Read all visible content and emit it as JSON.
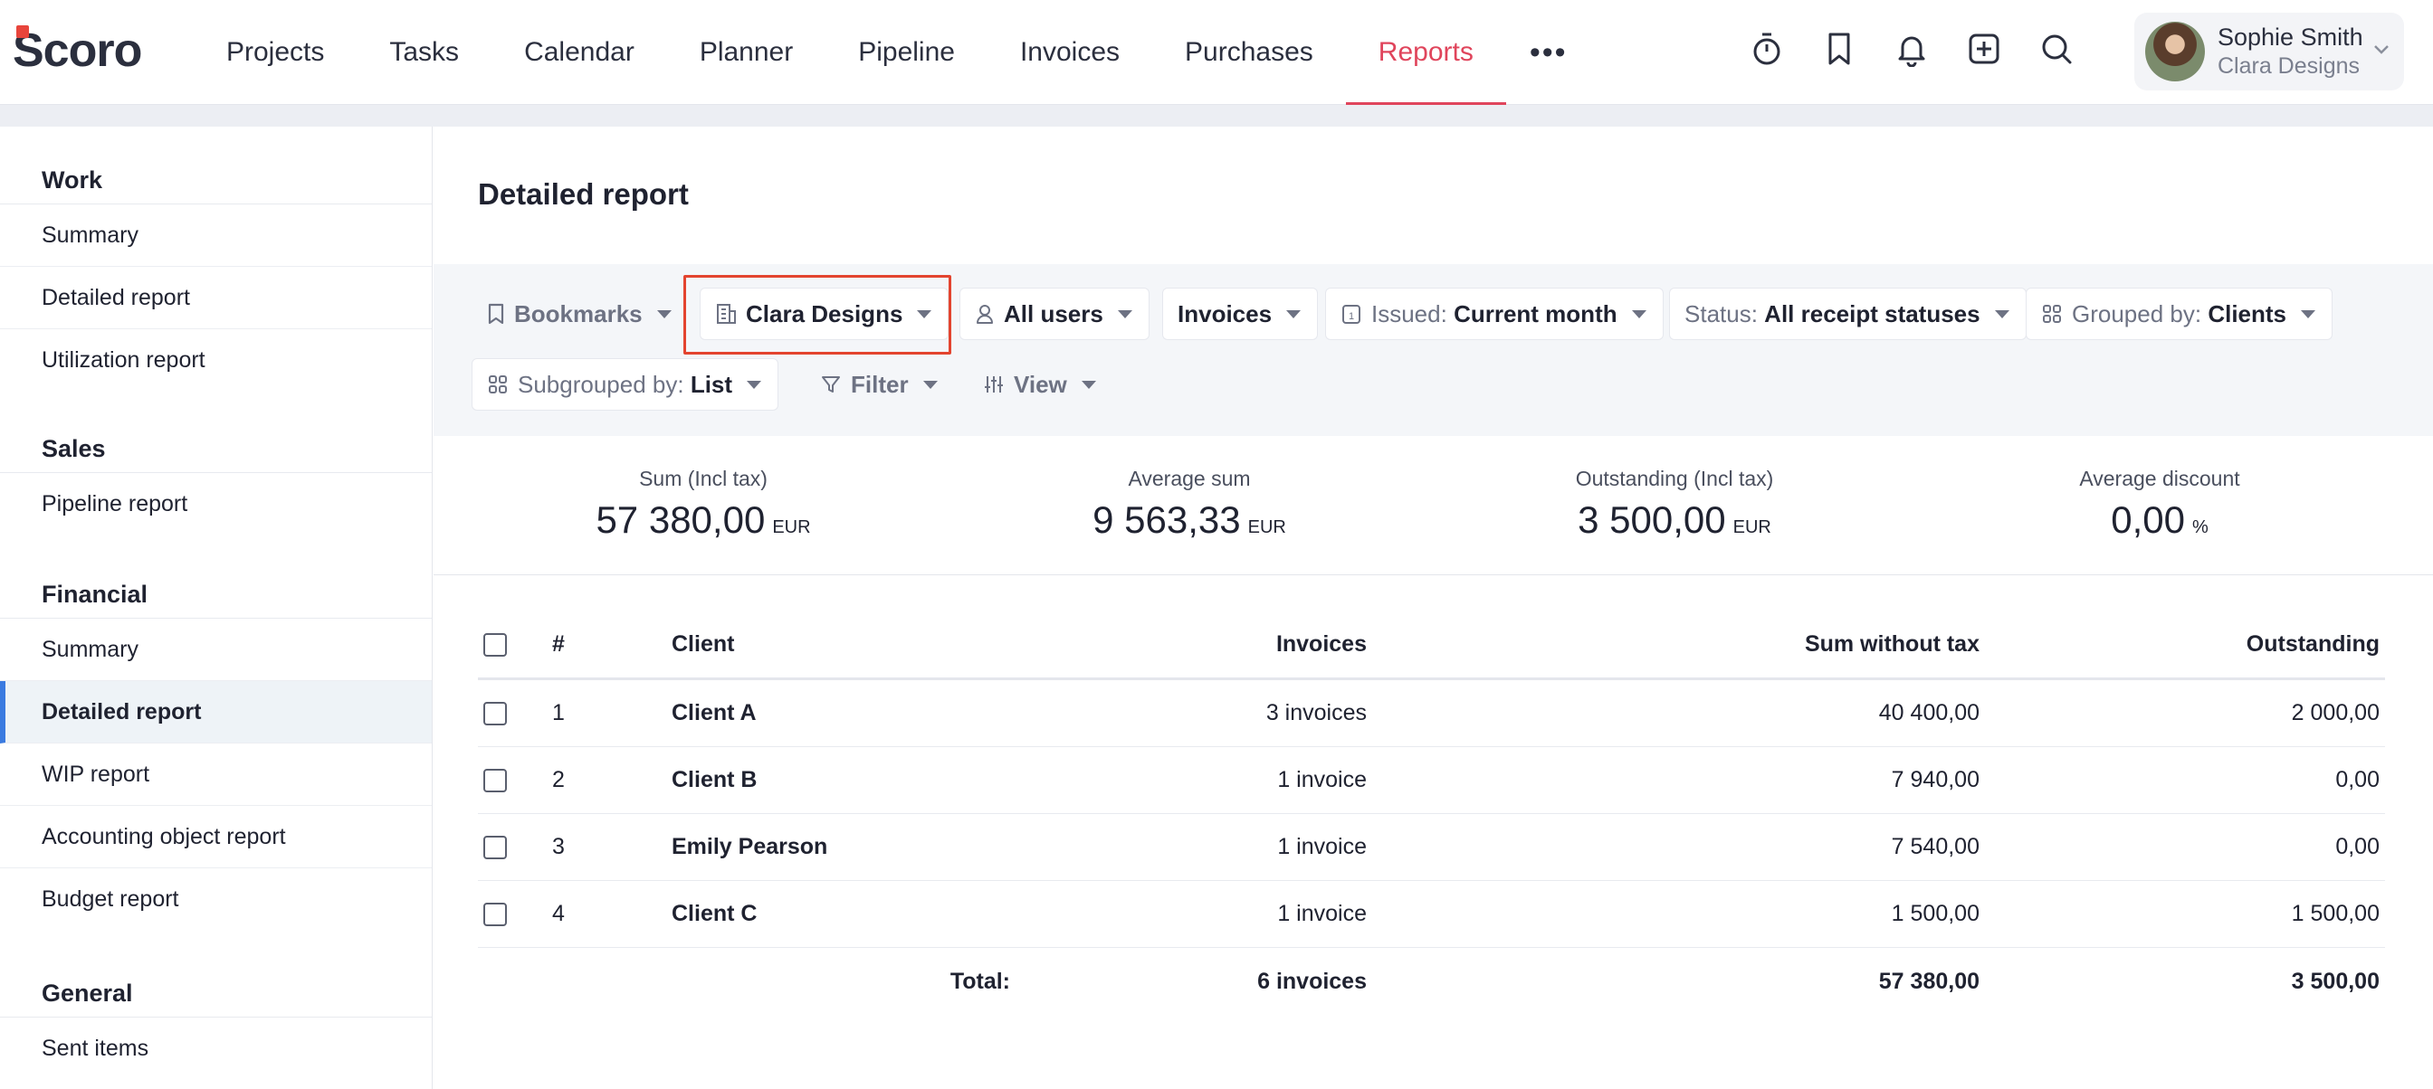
{
  "app": {
    "logo_text": "Scoro"
  },
  "nav": {
    "items": [
      "Projects",
      "Tasks",
      "Calendar",
      "Planner",
      "Pipeline",
      "Invoices",
      "Purchases",
      "Reports"
    ],
    "active": "Reports",
    "more_label": "•••"
  },
  "top_icons": [
    "timer-icon",
    "bookmark-icon",
    "bell-icon",
    "add-icon",
    "search-icon"
  ],
  "user": {
    "name": "Sophie Smith",
    "org": "Clara Designs"
  },
  "sidebar": {
    "sections": [
      {
        "title": "Work",
        "items": [
          "Summary",
          "Detailed report",
          "Utilization report"
        ]
      },
      {
        "title": "Sales",
        "items": [
          "Pipeline report"
        ]
      },
      {
        "title": "Financial",
        "items": [
          "Summary",
          "Detailed report",
          "WIP report",
          "Accounting object report",
          "Budget report"
        ]
      },
      {
        "title": "General",
        "items": [
          "Sent items"
        ]
      }
    ],
    "active_item": "Financial / Detailed report"
  },
  "page": {
    "title": "Detailed report"
  },
  "filters": {
    "bookmarks": "Bookmarks",
    "company": "Clara Designs",
    "users": "All users",
    "doc_type": "Invoices",
    "issued_label": "Issued:",
    "issued_value": "Current month",
    "status_label": "Status:",
    "status_value": "All receipt statuses",
    "grouped_label": "Grouped by:",
    "grouped_value": "Clients",
    "subgrouped_label": "Subgrouped by:",
    "subgrouped_value": "List",
    "filter": "Filter",
    "view": "View"
  },
  "stats": [
    {
      "label": "Sum (Incl tax)",
      "value": "57 380,00",
      "unit": "EUR"
    },
    {
      "label": "Average sum",
      "value": "9 563,33",
      "unit": "EUR"
    },
    {
      "label": "Outstanding (Incl tax)",
      "value": "3 500,00",
      "unit": "EUR"
    },
    {
      "label": "Average discount",
      "value": "0,00",
      "unit": "%"
    }
  ],
  "table": {
    "headers": {
      "num": "#",
      "client": "Client",
      "invoices": "Invoices",
      "sum": "Sum without tax",
      "outstanding": "Outstanding"
    },
    "rows": [
      {
        "num": "1",
        "client": "Client A",
        "invoices": "3 invoices",
        "sum": "40 400,00",
        "outstanding": "2 000,00"
      },
      {
        "num": "2",
        "client": "Client B",
        "invoices": "1 invoice",
        "sum": "7 940,00",
        "outstanding": "0,00"
      },
      {
        "num": "3",
        "client": "Emily Pearson",
        "invoices": "1 invoice",
        "sum": "7 540,00",
        "outstanding": "0,00"
      },
      {
        "num": "4",
        "client": "Client C",
        "invoices": "1 invoice",
        "sum": "1 500,00",
        "outstanding": "1 500,00"
      }
    ],
    "total": {
      "label": "Total:",
      "invoices": "6 invoices",
      "sum": "57 380,00",
      "outstanding": "3 500,00"
    }
  }
}
